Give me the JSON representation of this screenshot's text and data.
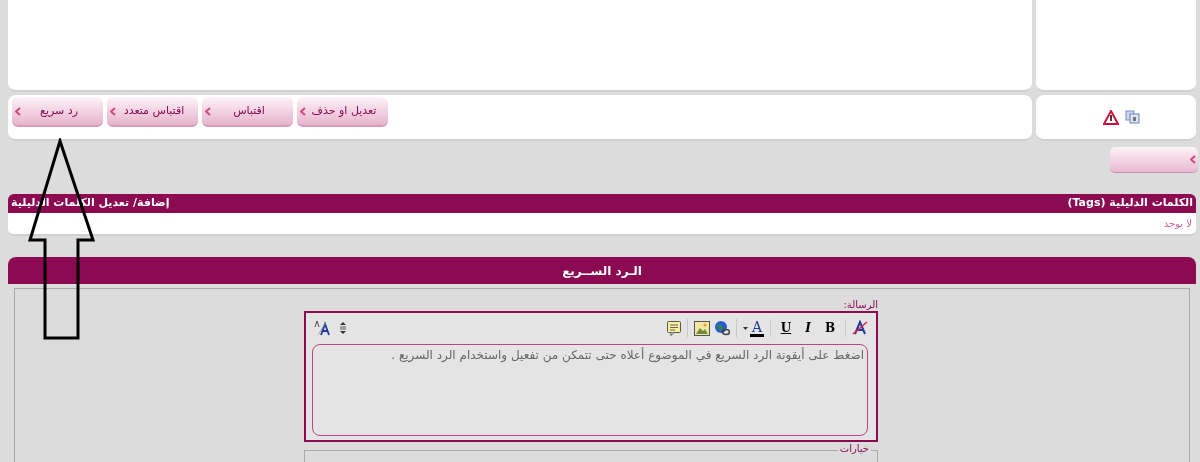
{
  "post_buttons": [
    {
      "label": "تعديل او حذف"
    },
    {
      "label": "اقتباس"
    },
    {
      "label": "اقتباس متعدد"
    },
    {
      "label": "رد سريع"
    }
  ],
  "tags": {
    "title": "الكلمات الدليلية (Tags)",
    "edit_link": "إضافة/ تعديل الكلمات الدليلية",
    "value": "لا يوجد"
  },
  "quick_reply": {
    "title": "الـرد الســريع",
    "message_label": "الرسالة:",
    "toolbar_right": [
      {
        "kind": "clear"
      },
      {
        "kind": "sep"
      },
      {
        "kind": "bold",
        "label": "B"
      },
      {
        "kind": "italic",
        "label": "I"
      },
      {
        "kind": "underline",
        "label": "U"
      },
      {
        "kind": "sep"
      },
      {
        "kind": "color",
        "label": "A"
      },
      {
        "kind": "sep"
      },
      {
        "kind": "link"
      },
      {
        "kind": "image"
      },
      {
        "kind": "sep"
      },
      {
        "kind": "quote"
      }
    ],
    "toolbar_left": [
      {
        "kind": "size"
      },
      {
        "kind": "switch"
      }
    ],
    "message": "اضغط على أيقونة الرد السريع في الموضوع أعلاه حتى تتمكن من تفعيل واستخدام الرد السريع .",
    "options_legend": "خيارات"
  }
}
